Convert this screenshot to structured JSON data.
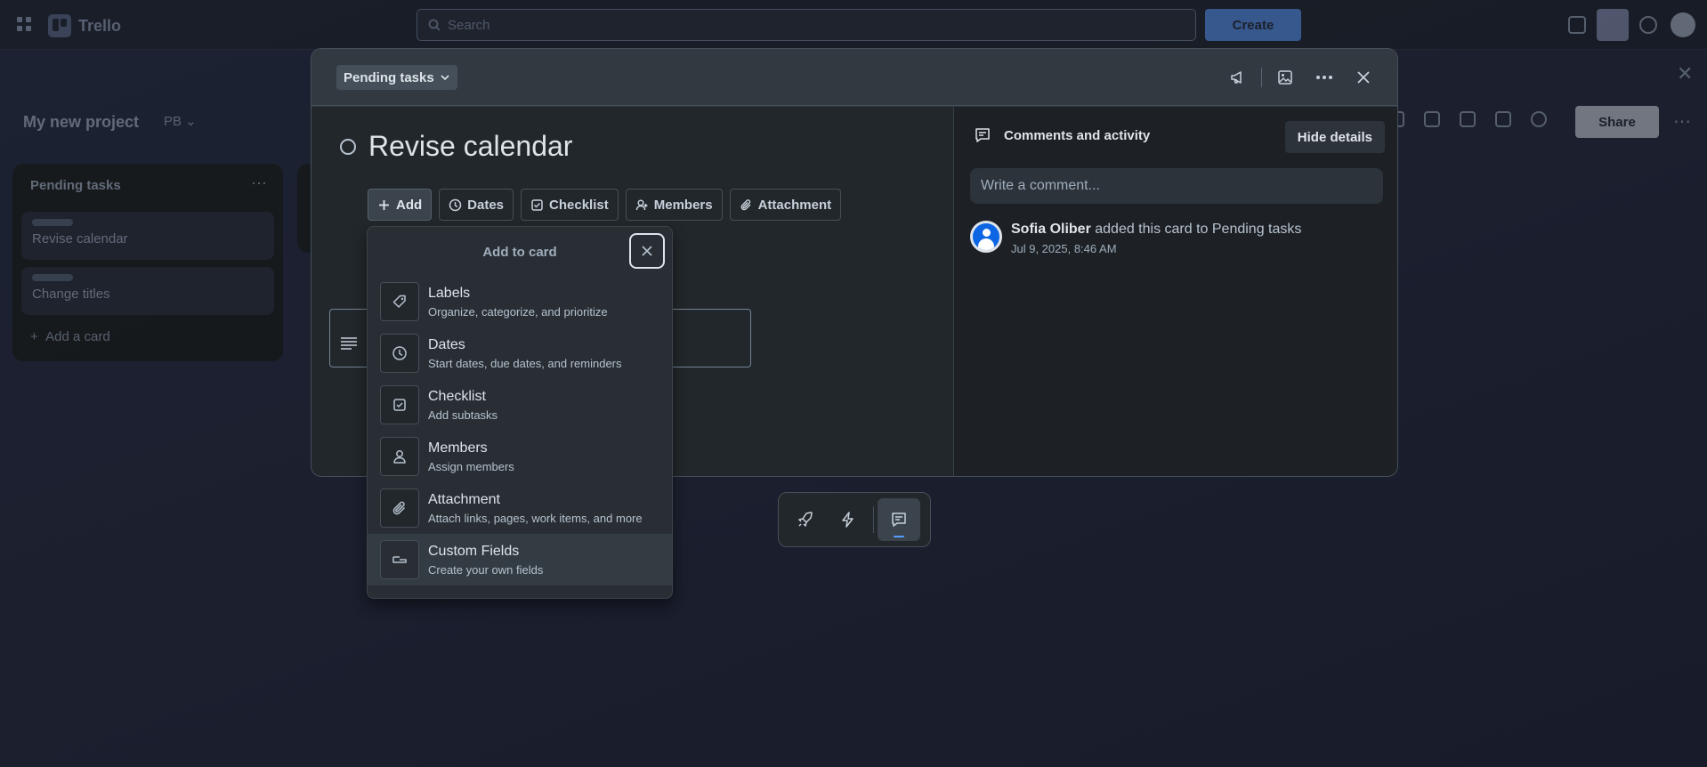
{
  "app": {
    "name": "Trello",
    "search_placeholder": "Search",
    "create_label": "Create"
  },
  "board": {
    "title": "My new project",
    "view_label": "PB",
    "share_label": "Share",
    "list": {
      "title": "Pending tasks",
      "cards": [
        "Revise calendar",
        "Change titles"
      ],
      "add_card_label": "Add a card"
    }
  },
  "card_modal": {
    "list_name": "Pending tasks",
    "title": "Revise calendar",
    "actions": [
      {
        "label": "Add",
        "icon": "plus-icon"
      },
      {
        "label": "Dates",
        "icon": "clock-icon"
      },
      {
        "label": "Checklist",
        "icon": "checklist-icon"
      },
      {
        "label": "Members",
        "icon": "add-member-icon"
      },
      {
        "label": "Attachment",
        "icon": "paperclip-icon"
      }
    ],
    "comments": {
      "heading": "Comments and activity",
      "hide_details_label": "Hide details",
      "input_placeholder": "Write a comment...",
      "activity": {
        "user": "Sofia Oliber",
        "action": " added this card to Pending tasks",
        "time": "Jul 9, 2025, 8:46 AM"
      }
    }
  },
  "add_to_card": {
    "title": "Add to card",
    "items": [
      {
        "name": "Labels",
        "desc": "Organize, categorize, and prioritize",
        "icon": "tag-icon"
      },
      {
        "name": "Dates",
        "desc": "Start dates, due dates, and reminders",
        "icon": "clock-icon"
      },
      {
        "name": "Checklist",
        "desc": "Add subtasks",
        "icon": "checkbox-icon"
      },
      {
        "name": "Members",
        "desc": "Assign members",
        "icon": "person-icon"
      },
      {
        "name": "Attachment",
        "desc": "Attach links, pages, work items, and more",
        "icon": "paperclip-icon"
      },
      {
        "name": "Custom Fields",
        "desc": "Create your own fields",
        "icon": "custom-field-icon"
      }
    ]
  },
  "colors": {
    "accent": "#579dff",
    "modal_bg": "#22272b",
    "panel_bg": "#1d2125"
  }
}
